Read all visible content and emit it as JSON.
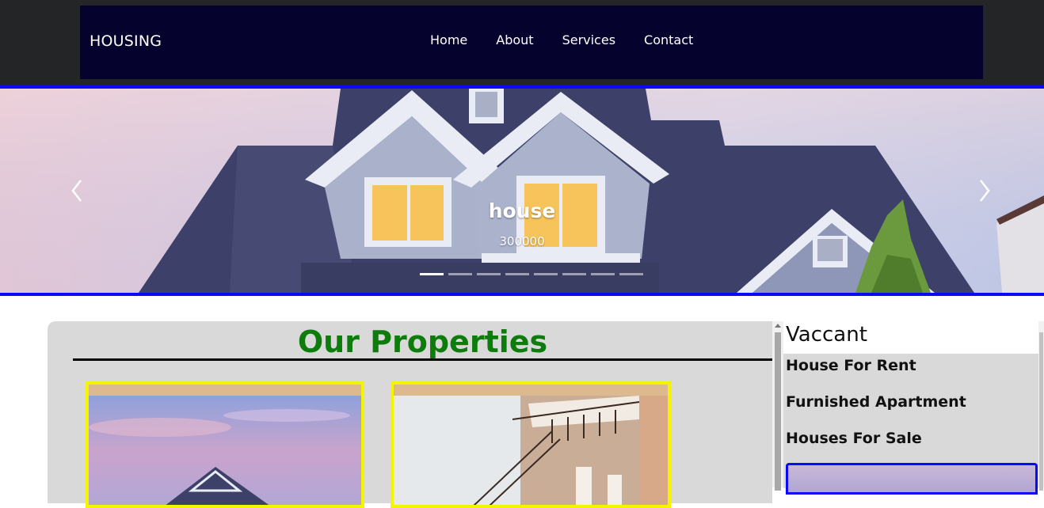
{
  "navbar": {
    "brand": "HOUSING",
    "links": [
      "Home",
      "About",
      "Services",
      "Contact"
    ]
  },
  "carousel": {
    "caption_title": "house",
    "caption_subtitle": "300000",
    "slide_count": 8,
    "active_index": 0,
    "prev_icon": "chevron-left-icon",
    "next_icon": "chevron-right-icon"
  },
  "properties": {
    "title": "Our Properties"
  },
  "sidebar": {
    "heading": "Vaccant",
    "items": [
      "House For Rent",
      "Furnished Apartment",
      "Houses For Sale"
    ]
  },
  "colors": {
    "navbar_bg": "#05032d",
    "accent_blue": "#0a0af5",
    "title_green": "#0d7c0d",
    "card_border": "#f4f400"
  }
}
